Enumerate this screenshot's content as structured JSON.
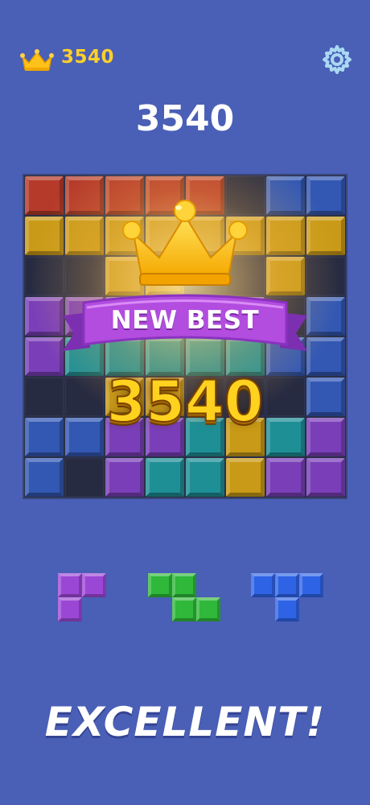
{
  "header": {
    "best_score": "3540",
    "crown_icon": "crown-icon",
    "settings_icon": "gear-icon"
  },
  "score": "3540",
  "celebration": {
    "banner_text": "NEW BEST",
    "new_score": "3540",
    "crown_icon": "crown-icon"
  },
  "board": {
    "size": 8,
    "colors": {
      "R": "#b53a2a",
      "Y": "#c99a17",
      "P": "#7a3fb8",
      "B": "#3358b3",
      "T": "#1f8f96",
      "E": "#272b41"
    },
    "rows": [
      "RRRRR.BB",
      "YYYYYYYY",
      "..YY..Y.",
      "PPPPPP.B",
      "PTTTTTBB",
      "..YY...B",
      "BBPPTYTP",
      "B.PTTYPP"
    ]
  },
  "pieces": [
    {
      "name": "piece-purple",
      "color": "#9b47d6",
      "cells": [
        [
          0,
          0
        ],
        [
          0,
          1
        ],
        [
          1,
          0
        ]
      ]
    },
    {
      "name": "piece-green",
      "color": "#2fb83a",
      "cells": [
        [
          0,
          0
        ],
        [
          0,
          1
        ],
        [
          1,
          1
        ],
        [
          1,
          2
        ]
      ]
    },
    {
      "name": "piece-blue",
      "color": "#2f63e6",
      "cells": [
        [
          0,
          0
        ],
        [
          0,
          1
        ],
        [
          0,
          2
        ],
        [
          1,
          1
        ]
      ]
    }
  ],
  "banner": {
    "text": "EXCELLENT!"
  }
}
